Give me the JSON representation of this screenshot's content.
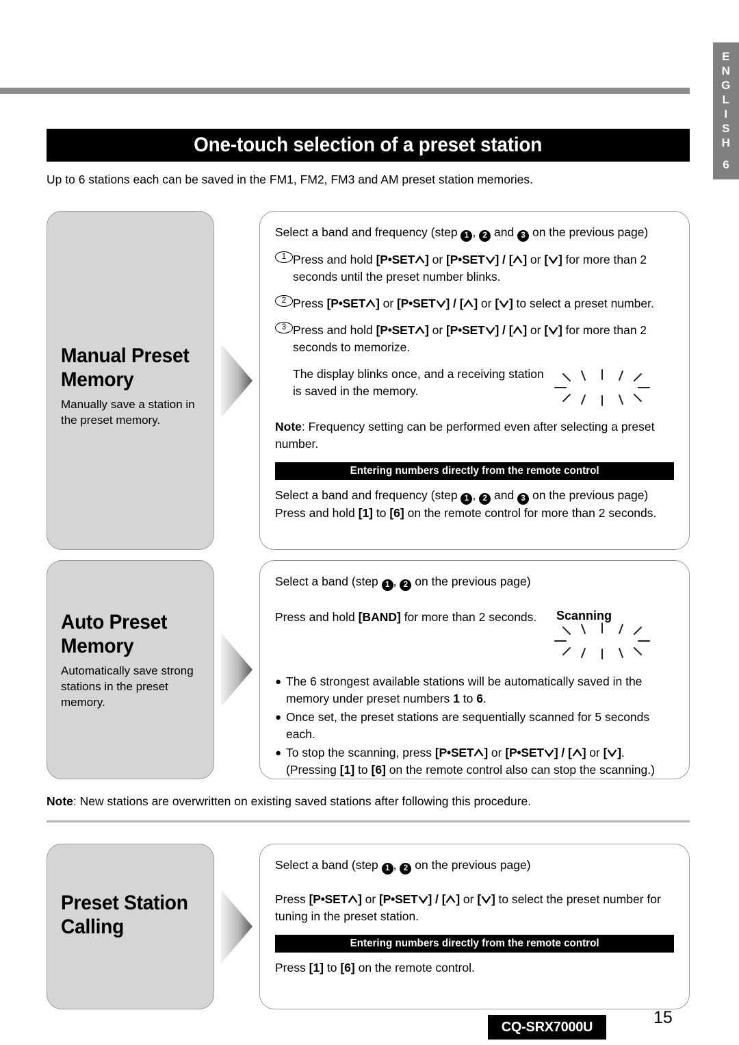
{
  "language_tab": {
    "letters": [
      "E",
      "N",
      "G",
      "L",
      "I",
      "S",
      "H"
    ],
    "number": "6"
  },
  "header": {
    "title": "One-touch selection of a preset station",
    "intro": "Up to 6 stations each can be saved in the FM1, FM2, FM3 and AM preset station memories."
  },
  "sections": [
    {
      "heading_line1": "Manual Preset",
      "heading_line2": "Memory",
      "description": "Manually save a station in the preset memory.",
      "content": {
        "lead": {
          "before": "Select a band and frequency (step ",
          "m1": "1",
          "sep1": ", ",
          "m2": "2",
          "sep2": " and ",
          "m3": "3",
          "after": " on the previous page)"
        },
        "steps": [
          {
            "num": "1",
            "parts": {
              "t1": "Press and hold ",
              "k1": "P•SET",
              "k2": " or ",
              "k3": "P•SET",
              "k4": " / ",
              "k5": " or ",
              "t2": " for more than 2 seconds until the preset number blinks."
            }
          },
          {
            "num": "2",
            "parts": {
              "t1": "Press ",
              "k1": "P•SET",
              "k2": " or ",
              "k3": "P•SET",
              "k4": " / ",
              "k5": " or ",
              "t2": " to select a  preset number."
            }
          },
          {
            "num": "3",
            "parts": {
              "t1": "Press and hold ",
              "k1": "P•SET",
              "k2": " or ",
              "k3": "P•SET",
              "k4": " / ",
              "k5": " or ",
              "t2": " for more than 2 seconds to memorize."
            }
          }
        ],
        "blink_caption": "The display blinks once, and a receiving station is saved in the memory.",
        "note_label": "Note",
        "note_text": ": Frequency setting can be performed even after selecting a preset number.",
        "remote_bar": "Entering numbers directly from the remote control",
        "remote_lead": {
          "before": "Select a band and frequency (step ",
          "m1": "1",
          "sep1": ", ",
          "m2": "2",
          "sep2": " and ",
          "m3": "3",
          "after": " on the previous page)"
        },
        "remote_line": {
          "t1": "Press and hold ",
          "k1": "1",
          "t2": " to ",
          "k2": "6",
          "t3": " on the remote control for more than 2 seconds."
        }
      }
    },
    {
      "heading_line1": "Auto Preset",
      "heading_line2": "Memory",
      "description": "Automatically save strong stations in the preset memory.",
      "content": {
        "lead": {
          "before": "Select a band (step ",
          "m1": "1",
          "sep1": ", ",
          "m2": "2",
          "after": " on the previous page)"
        },
        "press_line": {
          "t1": "Press and hold ",
          "k1": "[BAND]",
          "t2": " for more than 2 seconds."
        },
        "scanning_label": "Scanning",
        "bullets": [
          {
            "t1": "The 6 strongest available stations will be automatically saved in the memory under preset numbers ",
            "k1": "1",
            "t2": " to ",
            "k2": "6",
            "t3": "."
          },
          {
            "t1": "Once set, the preset stations are sequentially scanned for 5 seconds each.",
            "k1": "",
            "t2": "",
            "k2": "",
            "t3": ""
          },
          {
            "t1": "To stop the scanning, press ",
            "keys": true,
            "k1": "P•SET",
            "k2": " or ",
            "k3": "P•SET",
            "k4": " / ",
            "k5": " or ",
            "t2": ". (Pressing ",
            "k6": "1",
            "t3": " to ",
            "k7": "6",
            "t4": " on the remote control also can stop the scanning.)"
          }
        ]
      }
    },
    {
      "heading_line1": "Preset Station",
      "heading_line2": "Calling",
      "description": "",
      "content": {
        "lead": {
          "before": "Select a band (step ",
          "m1": "1",
          "sep1": ", ",
          "m2": "2",
          "after": " on the previous page)"
        },
        "press_line": {
          "t1": "Press ",
          "k1": "P•SET",
          "k2": " or ",
          "k3": "P•SET",
          "k4": " / ",
          "k5": " or ",
          "t2": " to select the preset number for tuning in the preset station."
        },
        "remote_bar": "Entering numbers directly from the remote control",
        "remote_line": {
          "t1": "Press ",
          "k1": "1",
          "t2": " to ",
          "k2": "6",
          "t3": " on the remote control."
        }
      }
    }
  ],
  "mid_note": {
    "label": "Note",
    "text": ": New stations are overwritten on existing saved stations after following this procedure."
  },
  "footer": {
    "model": "CQ-SRX7000U",
    "page_number": "15"
  },
  "colors": {
    "panel_gray": "#d5d5d5",
    "border_gray": "#9a9a9a",
    "rule_gray": "#8c8c8c",
    "tab_gray": "#808080",
    "black": "#000000"
  }
}
